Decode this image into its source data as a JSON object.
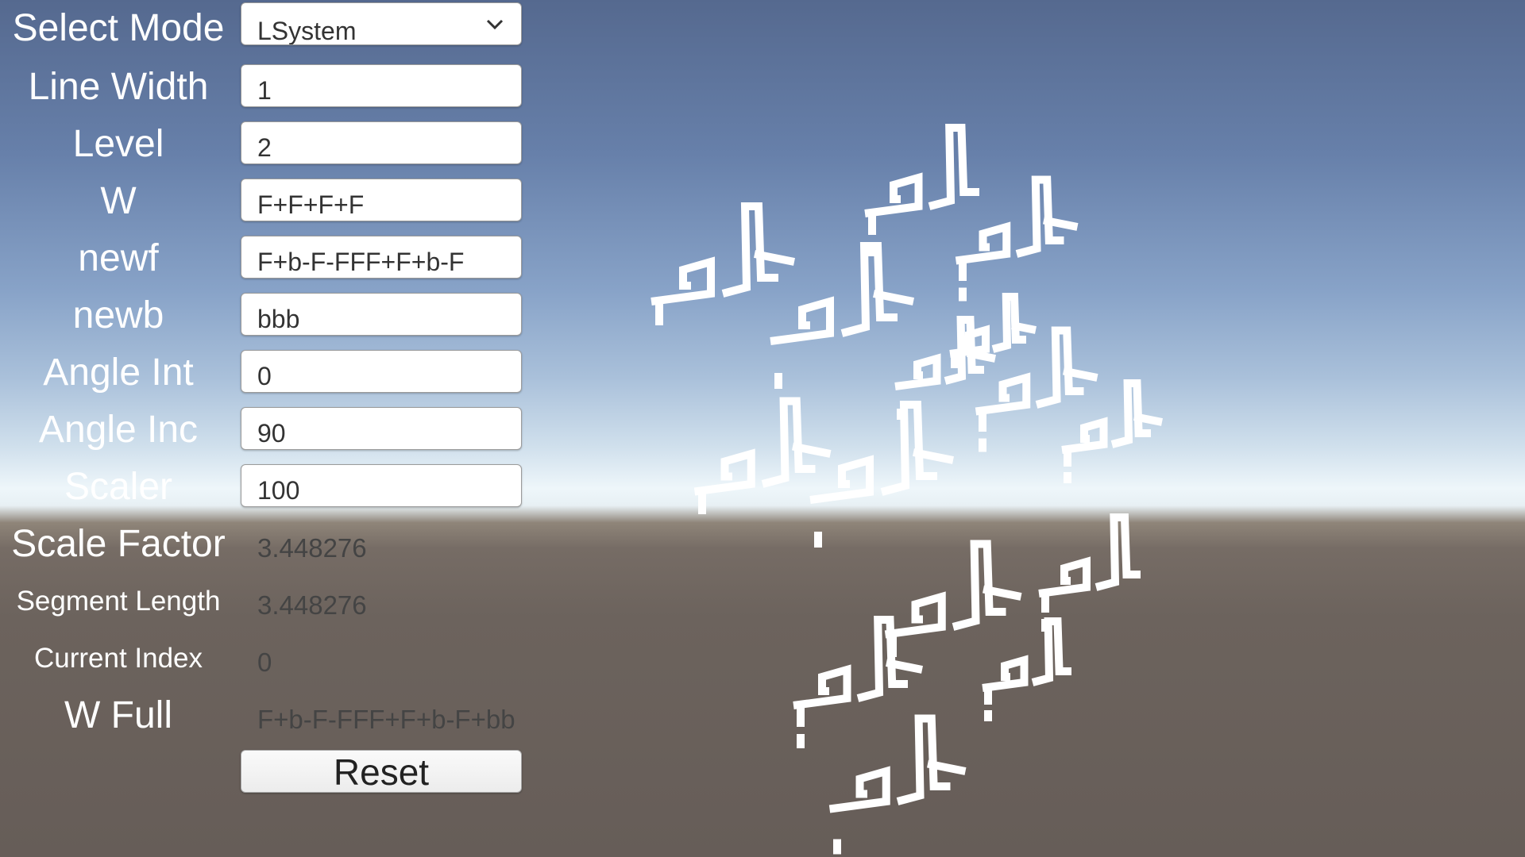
{
  "panel": {
    "select_mode": {
      "label": "Select Mode",
      "value": "LSystem"
    },
    "line_width": {
      "label": "Line Width",
      "value": "1"
    },
    "level": {
      "label": "Level",
      "value": "2"
    },
    "w": {
      "label": "W",
      "value": "F+F+F+F"
    },
    "newf": {
      "label": "newf",
      "value": "F+b-F-FFF+F+b-F"
    },
    "newb": {
      "label": "newb",
      "value": "bbb"
    },
    "angle_int": {
      "label": "Angle Int",
      "value": "0"
    },
    "angle_inc": {
      "label": "Angle Inc",
      "value": "90"
    },
    "scaler": {
      "label": "Scaler",
      "value": "100"
    },
    "scale_factor": {
      "label": "Scale Factor",
      "value": "3.448276"
    },
    "segment_length": {
      "label": "Segment Length",
      "value": "3.448276"
    },
    "current_index": {
      "label": "Current Index",
      "value": "0"
    },
    "w_full": {
      "label": "W Full",
      "value": "F+b-F-FFF+F+b-F+bb"
    },
    "reset_label": "Reset"
  },
  "icons": {
    "dropdown": "chevron-down-icon"
  },
  "colors": {
    "fractal_stroke": "#ffffff"
  }
}
